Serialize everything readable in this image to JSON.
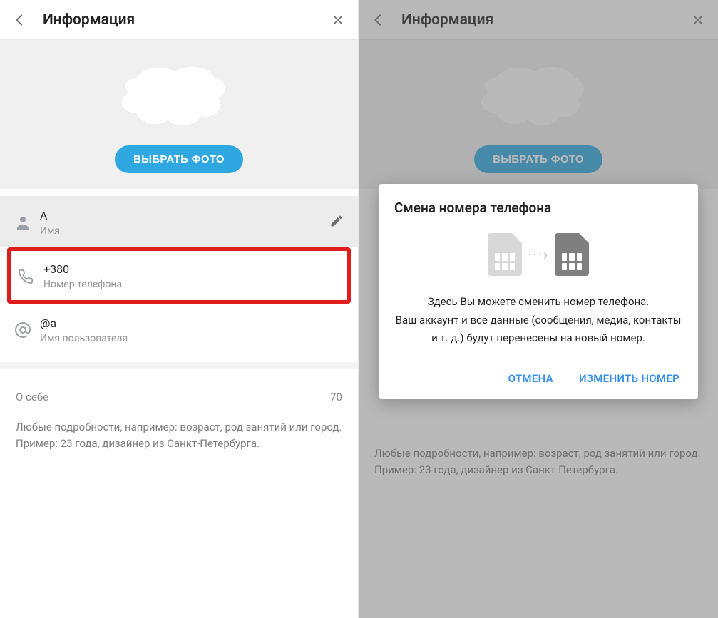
{
  "left": {
    "header": {
      "title": "Информация"
    },
    "choose_photo": "ВЫБРАТЬ ФОТО",
    "name": {
      "value": "A",
      "label": "Имя"
    },
    "phone": {
      "value": "+380",
      "label": "Номер телефона"
    },
    "username": {
      "value": "@a",
      "label": "Имя пользователя"
    },
    "about": {
      "label": "О себе",
      "counter": "70"
    },
    "hint_line1": "Любые подробности, например: возраст, род занятий или город.",
    "hint_line2": "Пример: 23 года, дизайнер из Санкт-Петербурга."
  },
  "right": {
    "header": {
      "title": "Информация"
    },
    "choose_photo": "ВЫБРАТЬ ФОТО",
    "hint_line1": "Любые подробности, например: возраст, род занятий или город.",
    "hint_line2": "Пример: 23 года, дизайнер из Санкт-Петербурга."
  },
  "modal": {
    "title": "Смена номера телефона",
    "body_line1": "Здесь Вы можете сменить номер телефона.",
    "body_line2": "Ваш аккаунт и все данные (сообщения, медиа, контакты",
    "body_line3": "и т. д.) будут перенесены на новый номер.",
    "cancel": "ОТМЕНА",
    "confirm": "ИЗМЕНИТЬ НОМЕР"
  }
}
